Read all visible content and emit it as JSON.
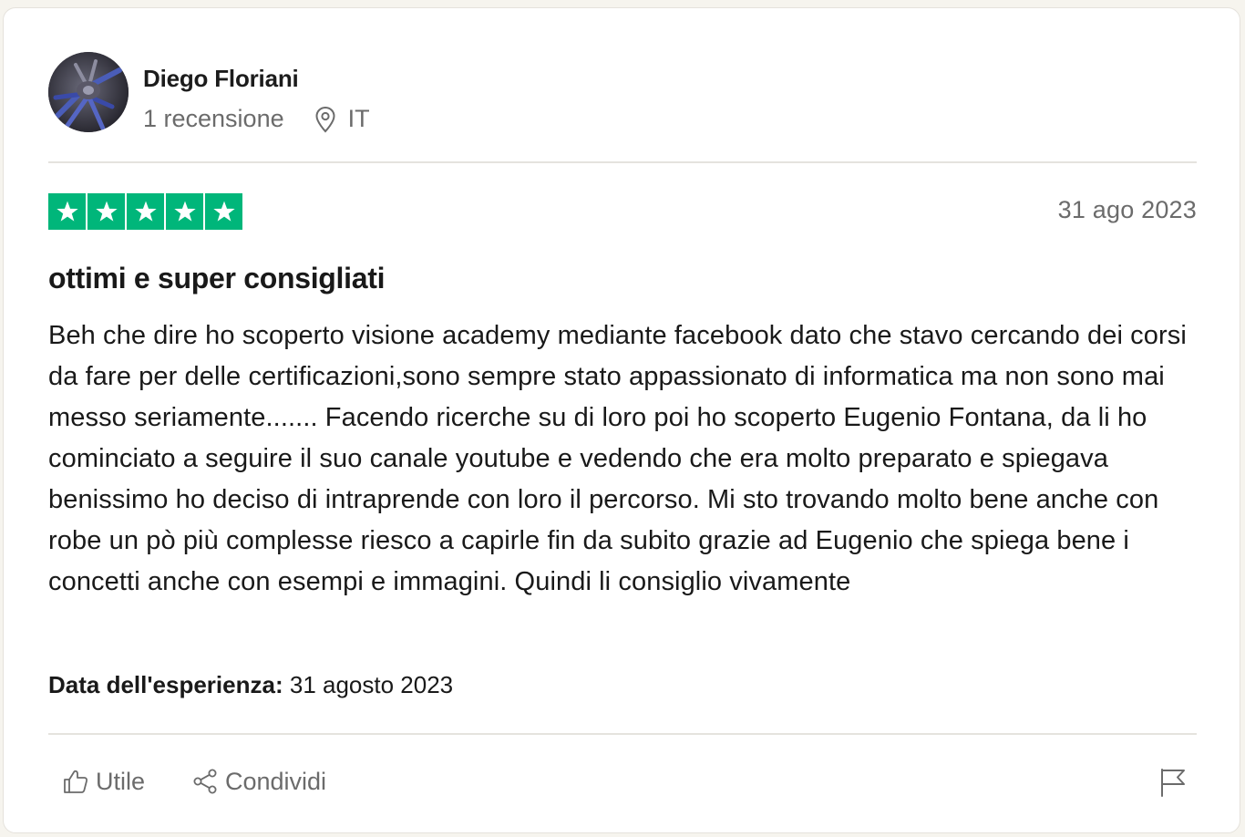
{
  "reviewer": {
    "name": "Diego Floriani",
    "reviews_count": "1 recensione",
    "country": "IT"
  },
  "review": {
    "rating": 5,
    "rating_max": 5,
    "date": "31 ago 2023",
    "title": "ottimi e super consigliati",
    "body": "Beh che dire ho scoperto visione academy mediante facebook dato che stavo cercando dei corsi da fare per delle certificazioni,sono sempre stato appassionato di informatica ma non sono mai messo seriamente....... Facendo ricerche su di loro poi ho scoperto Eugenio Fontana, da li ho cominciato a seguire il suo canale youtube e vedendo che era molto preparato e spiegava benissimo ho deciso di intraprende con loro il percorso. Mi sto trovando molto bene anche con robe un pò più complesse riesco a capirle fin da subito grazie ad Eugenio che spiega bene i concetti anche con esempi e immagini. Quindi li consiglio vivamente",
    "experience_label": "Data dell'esperienza:",
    "experience_date": "31 agosto 2023"
  },
  "actions": {
    "useful_label": "Utile",
    "share_label": "Condividi"
  },
  "icons": {
    "location": "location-pin-icon",
    "star": "star-icon",
    "thumbs_up": "thumbs-up-icon",
    "share": "share-icon",
    "flag": "flag-icon"
  },
  "colors": {
    "star_green": "#00b67a",
    "muted_text": "#6b6b6b",
    "divider": "#e5e3de"
  }
}
